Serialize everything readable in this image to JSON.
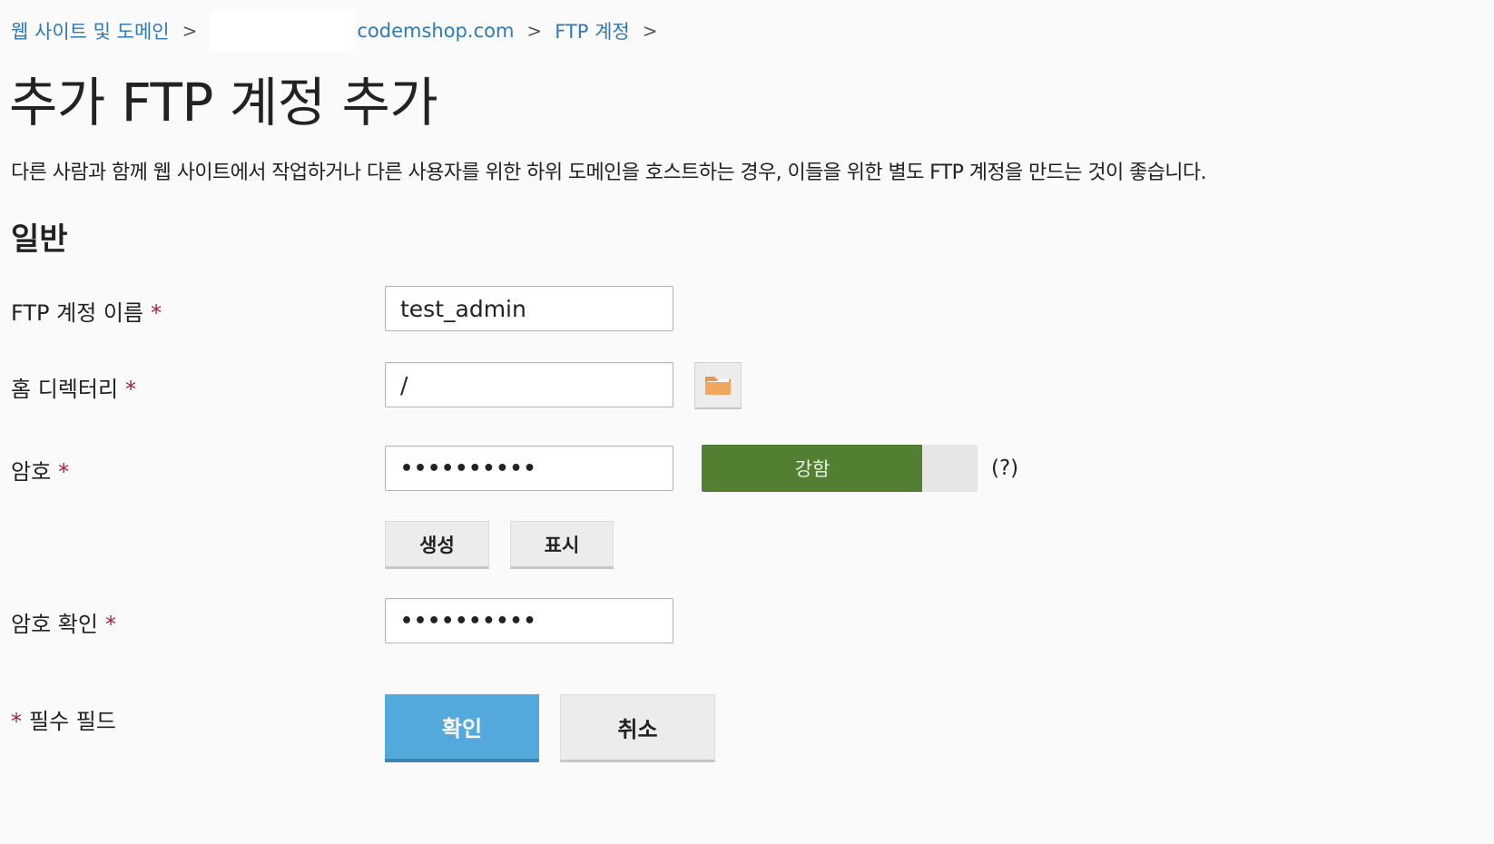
{
  "breadcrumb": {
    "item1": "웹 사이트 및 도메인",
    "item2": "codemshop.com",
    "item3": "FTP 계정",
    "separator": ">"
  },
  "title": "추가 FTP 계정 추가",
  "description": "다른 사람과 함께 웹 사이트에서 작업하거나 다른 사용자를 위한 하위 도메인을 호스트하는 경우, 이들을 위한 별도 FTP 계정을 만드는 것이 좋습니다.",
  "section_title": "일반",
  "required_mark": "*",
  "fields": {
    "ftp_name": {
      "label": "FTP 계정 이름",
      "value": "test_admin"
    },
    "home_dir": {
      "label": "홈 디렉터리",
      "value": "/"
    },
    "password": {
      "label": "암호",
      "value": "••••••••••"
    },
    "confirm": {
      "label": "암호 확인",
      "value": "••••••••••"
    }
  },
  "strength": {
    "label": "강함",
    "level": 0.8,
    "color": "#537f33"
  },
  "hint": "(?)",
  "buttons": {
    "generate": "생성",
    "show": "표시",
    "ok": "확인",
    "cancel": "취소"
  },
  "required_note": "필수 필드",
  "icons": {
    "browse": "folder-icon"
  },
  "colors": {
    "link": "#2f79b7",
    "primary": "#53a8dc",
    "required": "#a5223a"
  }
}
